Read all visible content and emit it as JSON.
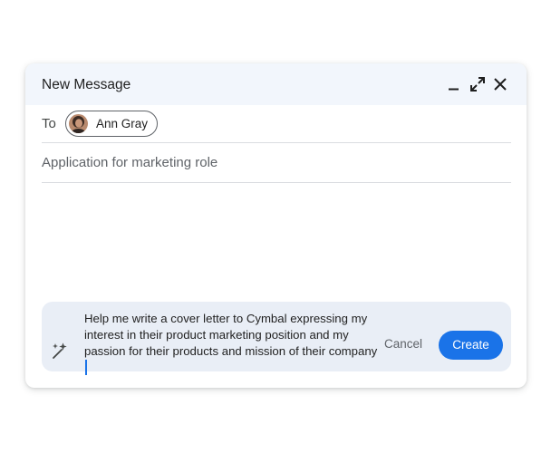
{
  "compose": {
    "title": "New Message",
    "to_label": "To",
    "recipient": "Ann Gray",
    "subject": "Application for marketing role",
    "help_me_write": {
      "prompt": "Help me write a cover letter to Cymbal expressing my interest in their product marketing position and my passion for their products and mission of their company",
      "cancel_label": "Cancel",
      "create_label": "Create"
    }
  },
  "colors": {
    "accent": "#1a73e8",
    "header_bg": "#f2f6fc",
    "prompt_panel_bg": "#e9eef6"
  },
  "icons": [
    "minimize-icon",
    "expand-icon",
    "close-icon",
    "magic-wand-icon"
  ]
}
